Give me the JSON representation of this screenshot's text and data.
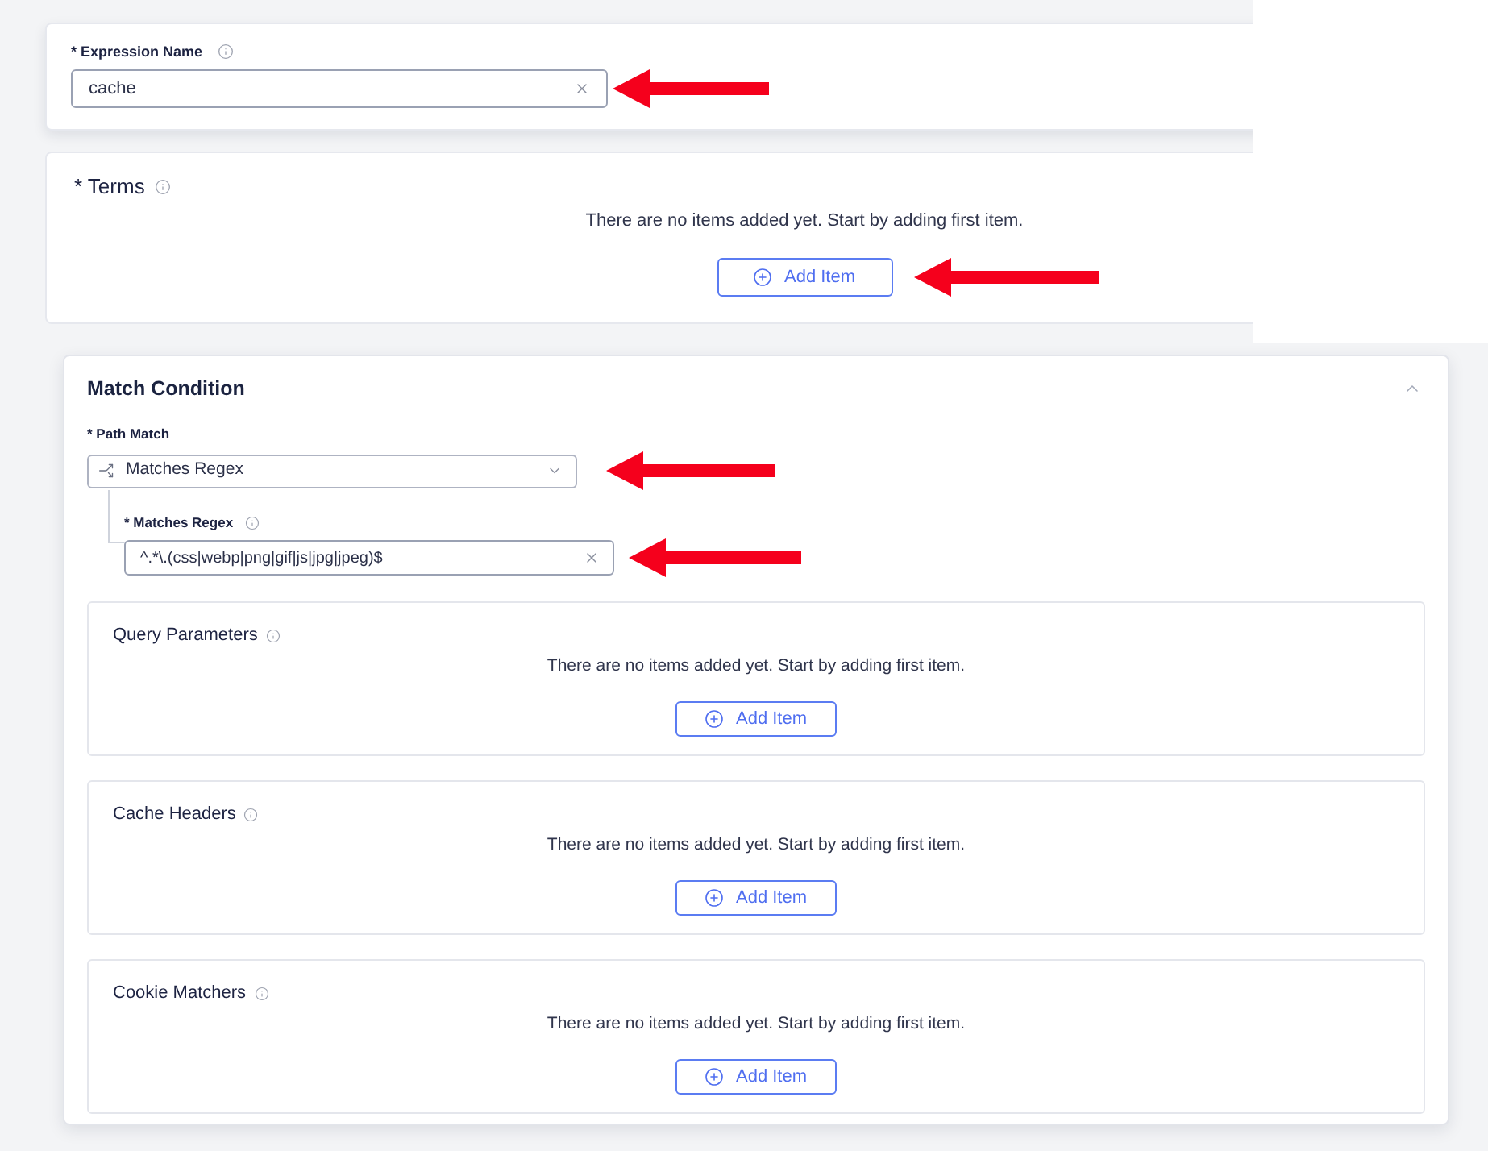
{
  "expression_name": {
    "label": "* Expression Name",
    "value": "cache",
    "arrow": true
  },
  "terms": {
    "title": "* Terms",
    "empty_text": "There are no items added yet. Start by adding first item.",
    "button": "Add Item",
    "arrow": true
  },
  "match_condition": {
    "title": "Match Condition",
    "expanded": true,
    "path_match": {
      "label": "* Path Match",
      "value": "Matches Regex",
      "arrow": true
    },
    "matches_regex": {
      "label": "* Matches Regex",
      "value": "^.*\\.(css|webp|png|gif|js|jpg|jpeg)$",
      "arrow": true
    },
    "sections": [
      {
        "title": "Query Parameters",
        "empty_text": "There are no items added yet. Start by adding first item.",
        "button": "Add Item"
      },
      {
        "title": "Cache Headers",
        "empty_text": "There are no items added yet. Start by adding first item.",
        "button": "Add Item"
      },
      {
        "title": "Cookie Matchers",
        "empty_text": "There are no items added yet. Start by adding first item.",
        "button": "Add Item"
      }
    ]
  }
}
